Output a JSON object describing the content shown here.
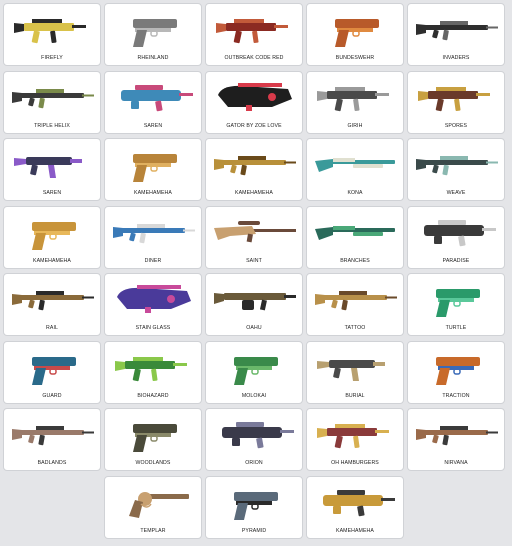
{
  "items": [
    {
      "label": "FIREFLY",
      "type": "smg",
      "color": "#d9c24a",
      "accent": "#2a2a2a"
    },
    {
      "label": "RHEINLAND",
      "type": "pistol",
      "color": "#7a7a7a",
      "accent": "#b8b8b8"
    },
    {
      "label": "OUTBREAK CODE RED",
      "type": "smg",
      "color": "#8b2a22",
      "accent": "#c25a3a"
    },
    {
      "label": "BUNDESWEHR",
      "type": "pistol",
      "color": "#b85a2a",
      "accent": "#e08a40"
    },
    {
      "label": "INVADERS",
      "type": "rifle",
      "color": "#2e2e2e",
      "accent": "#666666"
    },
    {
      "label": "TRIPLE HELIX",
      "type": "rifle",
      "color": "#3a3a3a",
      "accent": "#7a8a4a"
    },
    {
      "label": "SAREN",
      "type": "bullpup",
      "color": "#3e8ab8",
      "accent": "#c84a7a"
    },
    {
      "label": "GATOR BY ZOE LOVE",
      "type": "p90",
      "color": "#1e1e1e",
      "accent": "#d83a4a"
    },
    {
      "label": "GIRIH",
      "type": "smg",
      "color": "#4a4a4a",
      "accent": "#9a9a9a"
    },
    {
      "label": "SPORES",
      "type": "smg",
      "color": "#6a3a2a",
      "accent": "#c8a040"
    },
    {
      "label": "SAREN",
      "type": "mp5",
      "color": "#3a3a5a",
      "accent": "#8a5ac8"
    },
    {
      "label": "KAMEHAMEHA",
      "type": "pistol",
      "color": "#b8843a",
      "accent": "#e0b060"
    },
    {
      "label": "KAMEHAMEHA",
      "type": "rifle",
      "color": "#b8903a",
      "accent": "#6a4a1a"
    },
    {
      "label": "KONA",
      "type": "shotgun",
      "color": "#3a9a9a",
      "accent": "#e0e0d0"
    },
    {
      "label": "WEAVE",
      "type": "rifle",
      "color": "#3a4a4a",
      "accent": "#8ab8b0"
    },
    {
      "label": "KAMEHAMEHA",
      "type": "pistol",
      "color": "#c8943a",
      "accent": "#e8b85a"
    },
    {
      "label": "DINER",
      "type": "rifle",
      "color": "#3a7ab8",
      "accent": "#d8d8d8"
    },
    {
      "label": "SAINT",
      "type": "sniper",
      "color": "#c8a070",
      "accent": "#6a4a3a"
    },
    {
      "label": "BRANCHES",
      "type": "shotgun",
      "color": "#2a6a5a",
      "accent": "#4aa878"
    },
    {
      "label": "PARADISE",
      "type": "bullpup",
      "color": "#3a3a3a",
      "accent": "#c8c8c8"
    },
    {
      "label": "RAIL",
      "type": "rifle",
      "color": "#8a6a3a",
      "accent": "#2a2a2a"
    },
    {
      "label": "STAIN GLASS",
      "type": "p90",
      "color": "#4a3a9a",
      "accent": "#c84a9a"
    },
    {
      "label": "OAHU",
      "type": "lmg",
      "color": "#6a5a3a",
      "accent": "#2a2a2a"
    },
    {
      "label": "TATTOO",
      "type": "rifle",
      "color": "#b8904a",
      "accent": "#6a4a2a"
    },
    {
      "label": "TURTLE",
      "type": "pistol",
      "color": "#2a9a6a",
      "accent": "#5ac89a"
    },
    {
      "label": "GUARD",
      "type": "pistol",
      "color": "#2a6a8a",
      "accent": "#c84a4a"
    },
    {
      "label": "BIOHAZARD",
      "type": "smg",
      "color": "#3a8a3a",
      "accent": "#8ac84a"
    },
    {
      "label": "MOLOKAI",
      "type": "pistol",
      "color": "#3a8a4a",
      "accent": "#6ab86a"
    },
    {
      "label": "BURIAL",
      "type": "mp5",
      "color": "#4a4a4a",
      "accent": "#b8a070"
    },
    {
      "label": "TRACTION",
      "type": "pistol",
      "color": "#c86a2a",
      "accent": "#3a6ab8"
    },
    {
      "label": "BADLANDS",
      "type": "rifle",
      "color": "#9a7a6a",
      "accent": "#3a3a3a"
    },
    {
      "label": "WOODLANDS",
      "type": "pistol",
      "color": "#4a4a3a",
      "accent": "#8a8a6a"
    },
    {
      "label": "ORION",
      "type": "bullpup",
      "color": "#3a3a4a",
      "accent": "#7a7a9a"
    },
    {
      "label": "OH HAMBURGERS",
      "type": "smg",
      "color": "#8a3a3a",
      "accent": "#d8b050"
    },
    {
      "label": "NIRVANA",
      "type": "rifle",
      "color": "#9a6a4a",
      "accent": "#3a3a3a"
    },
    {
      "label": "TEMPLAR",
      "type": "revolver",
      "color": "#8a6a4a",
      "accent": "#c8a070"
    },
    {
      "label": "PYRAMID",
      "type": "pistol",
      "color": "#5a6a7a",
      "accent": "#2a2a2a"
    },
    {
      "label": "KAMEHAMEHA",
      "type": "bullpup",
      "color": "#c89a3a",
      "accent": "#3a3a3a"
    }
  ]
}
